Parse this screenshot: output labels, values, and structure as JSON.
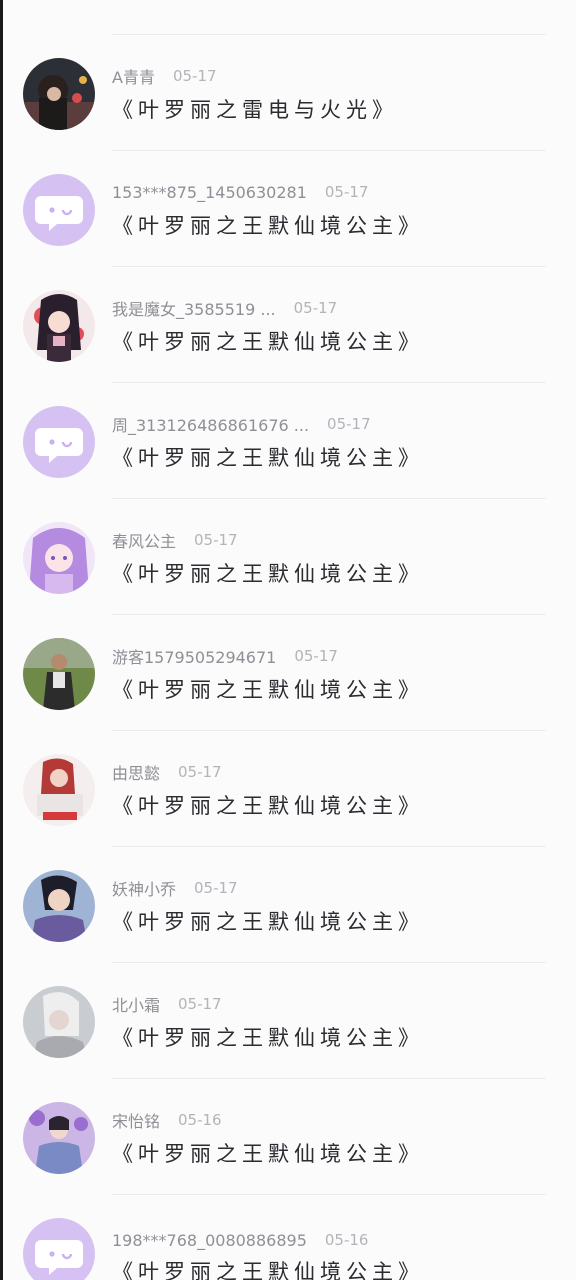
{
  "theme": {
    "placeholder_avatar_bg": "#d6c2f2",
    "placeholder_icon": "#ffffff"
  },
  "comments": [
    {
      "username": "A青青",
      "date": "05-17",
      "title": "《叶罗丽之雷电与火光》",
      "avatar": "photo-night-girl"
    },
    {
      "username": "153***875_1450630281",
      "date": "05-17",
      "title": "《叶罗丽之王默仙境公主》",
      "avatar": "default-chat-bubble"
    },
    {
      "username": "我是魔女_3585519 ...",
      "date": "05-17",
      "title": "《叶罗丽之王默仙境公主》",
      "avatar": "anime-girl-red"
    },
    {
      "username": "周_313126486861676 ...",
      "date": "05-17",
      "title": "《叶罗丽之王默仙境公主》",
      "avatar": "default-chat-bubble"
    },
    {
      "username": "春风公主",
      "date": "05-17",
      "title": "《叶罗丽之王默仙境公主》",
      "avatar": "anime-girl-purple"
    },
    {
      "username": "游客1579505294671",
      "date": "05-17",
      "title": "《叶罗丽之王默仙境公主》",
      "avatar": "photo-outdoor-woman"
    },
    {
      "username": "由思懿",
      "date": "05-17",
      "title": "《叶罗丽之王默仙境公主》",
      "avatar": "photo-girl-white"
    },
    {
      "username": "妖神小乔",
      "date": "05-17",
      "title": "《叶罗丽之王默仙境公主》",
      "avatar": "art-man-costume"
    },
    {
      "username": "北小霜",
      "date": "05-17",
      "title": "《叶罗丽之王默仙境公主》",
      "avatar": "art-silver-hair"
    },
    {
      "username": "宋怡铭",
      "date": "05-16",
      "title": "《叶罗丽之王默仙境公主》",
      "avatar": "art-purple-flowers"
    },
    {
      "username": "198***768_0080886895",
      "date": "05-16",
      "title": "《叶罗丽之王默仙境公主》",
      "avatar": "default-chat-bubble"
    }
  ]
}
